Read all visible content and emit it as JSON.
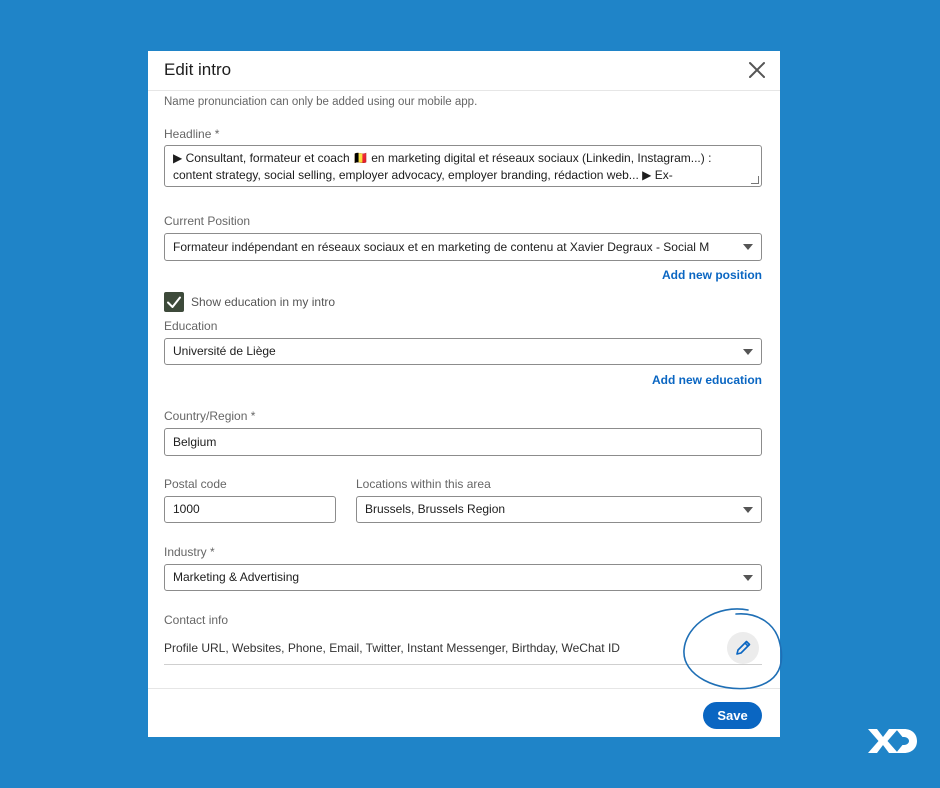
{
  "modal": {
    "title": "Edit intro",
    "note": "Name pronunciation can only be added using our mobile app."
  },
  "headline": {
    "label": "Headline *",
    "value": "▶ Consultant, formateur et coach 🇧🇪 en marketing digital et réseaux sociaux (Linkedin, Instagram...) : content strategy, social selling, employer advocacy, employer branding, rédaction web... ▶ Ex-"
  },
  "current_position": {
    "label": "Current Position",
    "value": "Formateur indépendant en réseaux sociaux et en marketing de contenu at Xavier Degraux - Social M",
    "add_link": "Add new position"
  },
  "show_education": {
    "label": "Show education in my intro",
    "checked": true
  },
  "education": {
    "label": "Education",
    "value": "Université de Liège",
    "add_link": "Add new education"
  },
  "country": {
    "label": "Country/Region *",
    "value": "Belgium"
  },
  "postal": {
    "label": "Postal code",
    "value": "1000"
  },
  "locations": {
    "label": "Locations within this area",
    "value": "Brussels, Brussels Region"
  },
  "industry": {
    "label": "Industry *",
    "value": "Marketing & Advertising"
  },
  "contact": {
    "label": "Contact info",
    "value": "Profile URL, Websites, Phone, Email, Twitter, Instant Messenger, Birthday, WeChat ID"
  },
  "footer": {
    "save_label": "Save"
  },
  "colors": {
    "background": "#1f84c8",
    "accent": "#0a66c2",
    "checkbox": "#3d4a3a"
  },
  "icons": {
    "close": "close-icon",
    "check": "check-icon",
    "caret": "chevron-down-icon",
    "edit": "pencil-icon",
    "logo": "xd-logo-icon"
  }
}
